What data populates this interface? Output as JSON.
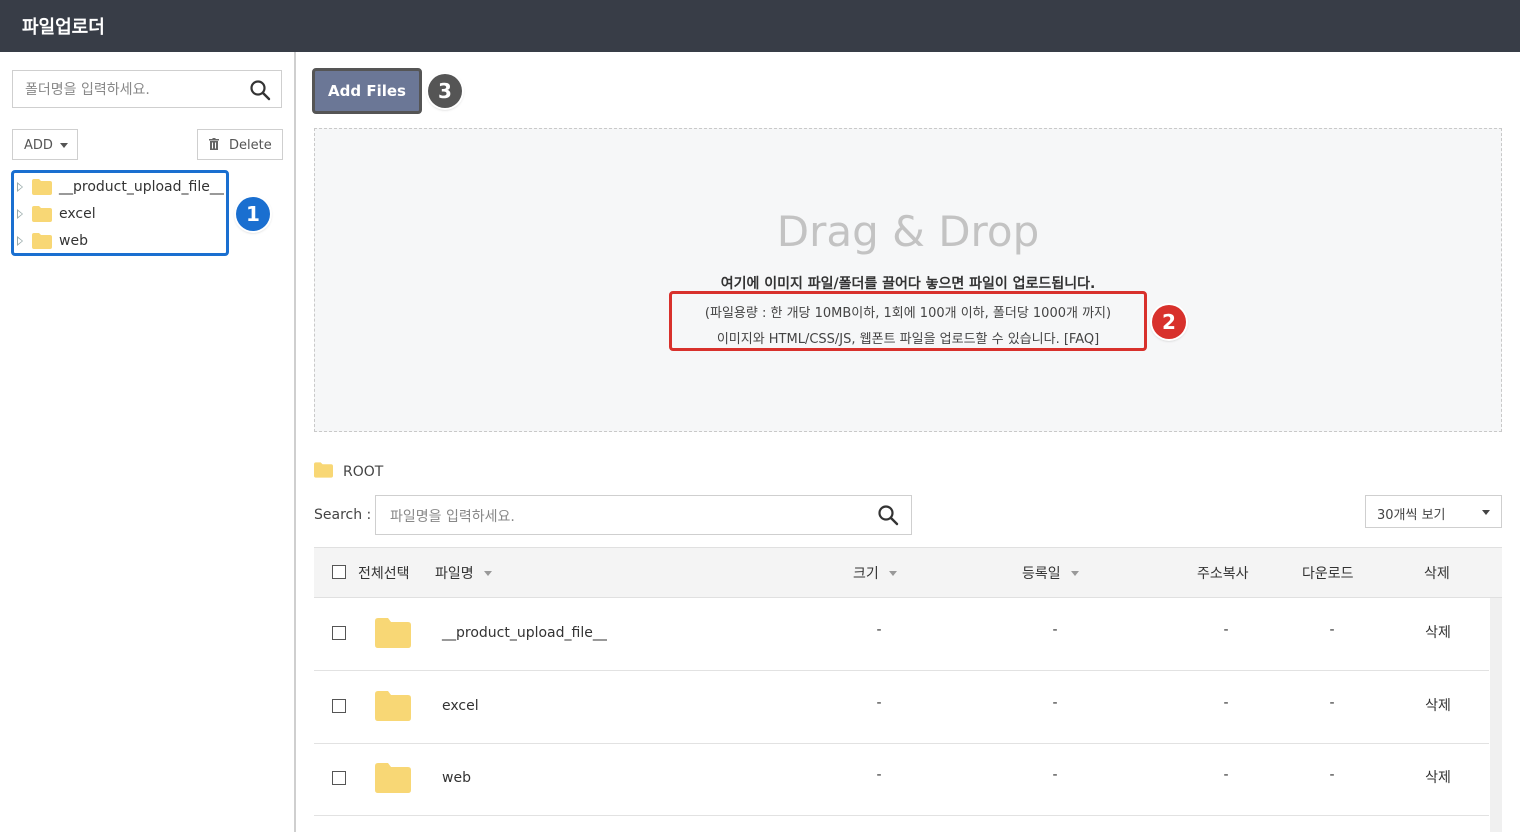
{
  "app": {
    "title": "파일업로더"
  },
  "sidebar": {
    "search_placeholder": "폴더명을 입력하세요.",
    "add_label": "ADD",
    "delete_label": "Delete",
    "tree": [
      {
        "name": "__product_upload_file__"
      },
      {
        "name": "excel"
      },
      {
        "name": "web"
      }
    ],
    "badge": "1"
  },
  "toolbar": {
    "add_files_label": "Add Files",
    "badge": "3"
  },
  "dropzone": {
    "title": "Drag & Drop",
    "main_text": "여기에 이미지 파일/폴더를 끌어다 놓으면 파일이 업로드됩니다.",
    "note_line1": "(파일용량 : 한 개당 10MB이하, 1회에 100개 이하, 폴더당 1000개 까지)",
    "note_line2": "이미지와 HTML/CSS/JS, 웹폰트 파일을 업로드할 수 있습니다. [FAQ]",
    "badge": "2"
  },
  "breadcrumb": {
    "root": "ROOT"
  },
  "filter": {
    "search_label": "Search :",
    "search_placeholder": "파일명을 입력하세요.",
    "per_page": "30개씩 보기"
  },
  "table": {
    "headers": {
      "select_all": "전체선택",
      "name": "파일명",
      "size": "크기",
      "date": "등록일",
      "copy_url": "주소복사",
      "download": "다운로드",
      "delete": "삭제"
    },
    "rows": [
      {
        "name": "__product_upload_file__",
        "size": "-",
        "date": "-",
        "copy_url": "-",
        "download": "-",
        "delete": "삭제"
      },
      {
        "name": "excel",
        "size": "-",
        "date": "-",
        "copy_url": "-",
        "download": "-",
        "delete": "삭제"
      },
      {
        "name": "web",
        "size": "-",
        "date": "-",
        "copy_url": "-",
        "download": "-",
        "delete": "삭제"
      }
    ]
  },
  "colors": {
    "titlebar": "#383d47",
    "folder": "#f8d775",
    "accent_blue": "#1a6fd0",
    "accent_red": "#d8312c",
    "button": "#6b7796"
  }
}
